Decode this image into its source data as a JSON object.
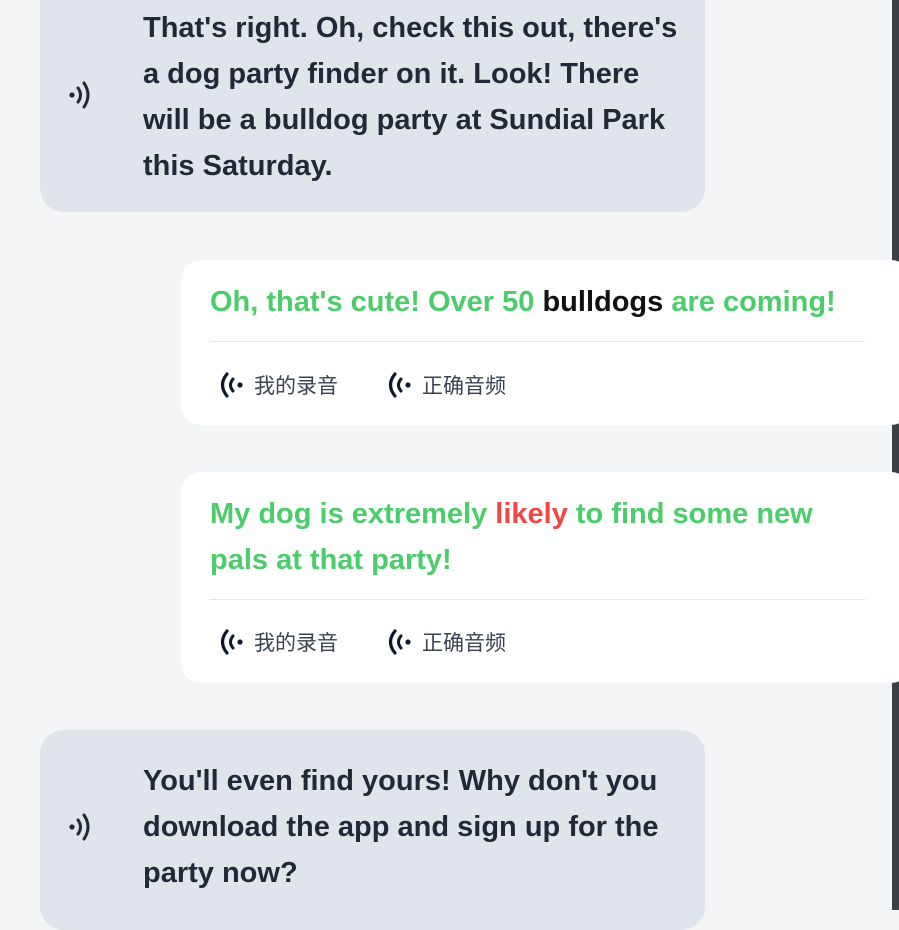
{
  "conversation": {
    "messages": [
      {
        "id": "msg1",
        "role": "speaker",
        "text": "That's right. Oh, check this out, there's a dog party finder on it. Look! There will be a bulldog party at Sundial Park this Saturday."
      },
      {
        "id": "msg2",
        "role": "user",
        "segments": [
          {
            "text": "Oh, that's cute! Over 50 ",
            "state": "correct"
          },
          {
            "text": "bulldogs",
            "state": "neutral"
          },
          {
            "text": " are coming!",
            "state": "correct"
          }
        ],
        "actions": {
          "my_recording": "我的录音",
          "correct_audio": "正确音频"
        }
      },
      {
        "id": "msg3",
        "role": "user",
        "segments": [
          {
            "text": "My dog is extremely ",
            "state": "correct"
          },
          {
            "text": "likely",
            "state": "wrong"
          },
          {
            "text": " to find some new pals at that party!",
            "state": "correct"
          }
        ],
        "actions": {
          "my_recording": "我的录音",
          "correct_audio": "正确音频"
        }
      },
      {
        "id": "msg4",
        "role": "speaker",
        "text": "You'll even find yours! Why don't you download the app and sign up for the party now?"
      }
    ]
  },
  "colors": {
    "correct": "#4ccc6a",
    "wrong": "#f04646",
    "neutral": "#111111",
    "speaker_bubble": "#e0e5ec",
    "card": "#ffffff"
  },
  "icons": {
    "speaker": "speaker-wave-icon",
    "audio": "audio-wave-icon"
  }
}
